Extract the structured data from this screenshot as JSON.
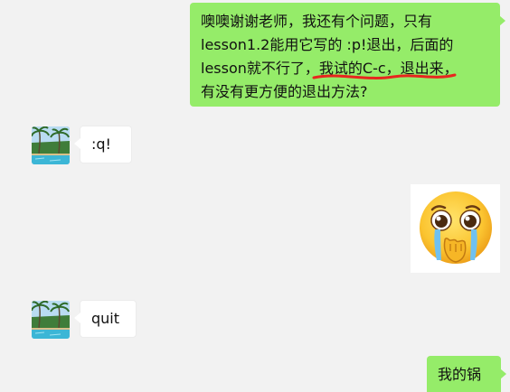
{
  "conversation": {
    "messages": [
      {
        "sender": "me",
        "type": "text",
        "lines": [
          "噢噢谢谢老师，我还有个问题，只有",
          "lesson1.2能用它写的 :p!退出，后面的",
          "lesson就不行了，",
          "我试的C-c，退出来",
          "，",
          "有没有更方便的退出方法?"
        ]
      },
      {
        "sender": "teacher",
        "type": "text",
        "text": ":q!"
      },
      {
        "sender": "me",
        "type": "image",
        "icon": "crying-face-emoji-icon"
      },
      {
        "sender": "teacher",
        "type": "text",
        "text": "quit"
      },
      {
        "sender": "me",
        "type": "text",
        "text": "我的锅"
      }
    ]
  },
  "colors": {
    "background": "#f2f2f2",
    "outgoing_bubble": "#95ec69",
    "incoming_bubble": "#ffffff",
    "strike_mark": "#e8261e"
  },
  "avatar": {
    "icon": "tropical-pool-avatar-icon"
  }
}
